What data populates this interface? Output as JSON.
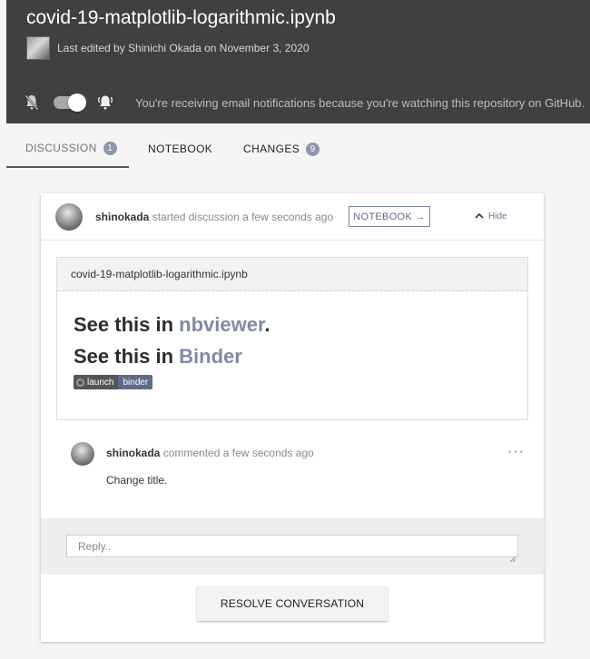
{
  "header": {
    "file_title": "covid-19-matplotlib-logarithmic.ipynb",
    "edited_text": "Last edited by Shinichi Okada on November 3, 2020",
    "notification_text": "You're receiving email notifications because you're watching this repository on GitHub."
  },
  "tabs": [
    {
      "label": "DISCUSSION",
      "count": "1",
      "active": true
    },
    {
      "label": "NOTEBOOK"
    },
    {
      "label": "CHANGES",
      "count": "9"
    }
  ],
  "discussion": {
    "author": "shinokada",
    "started_text": "started discussion a few seconds ago",
    "notebook_button": "NOTEBOOK →",
    "hide_label": "Hide",
    "notebook_file": "covid-19-matplotlib-logarithmic.ipynb",
    "see_line_1": {
      "prefix": "See this in ",
      "link": "nbviewer",
      "suffix": "."
    },
    "see_line_2": {
      "prefix": "See this in ",
      "link": "Binder"
    },
    "badge": {
      "left": "launch",
      "right": "binder"
    },
    "comment": {
      "author": "shinokada",
      "meta": "commented a few seconds ago",
      "body": "Change title.",
      "more": "···"
    },
    "reply_placeholder": "Reply..",
    "resolve_button": "RESOLVE CONVERSATION"
  },
  "colors": {
    "header_bg": "#404040",
    "accent": "#7f8aa6",
    "badge_count": "#8d96aa"
  }
}
